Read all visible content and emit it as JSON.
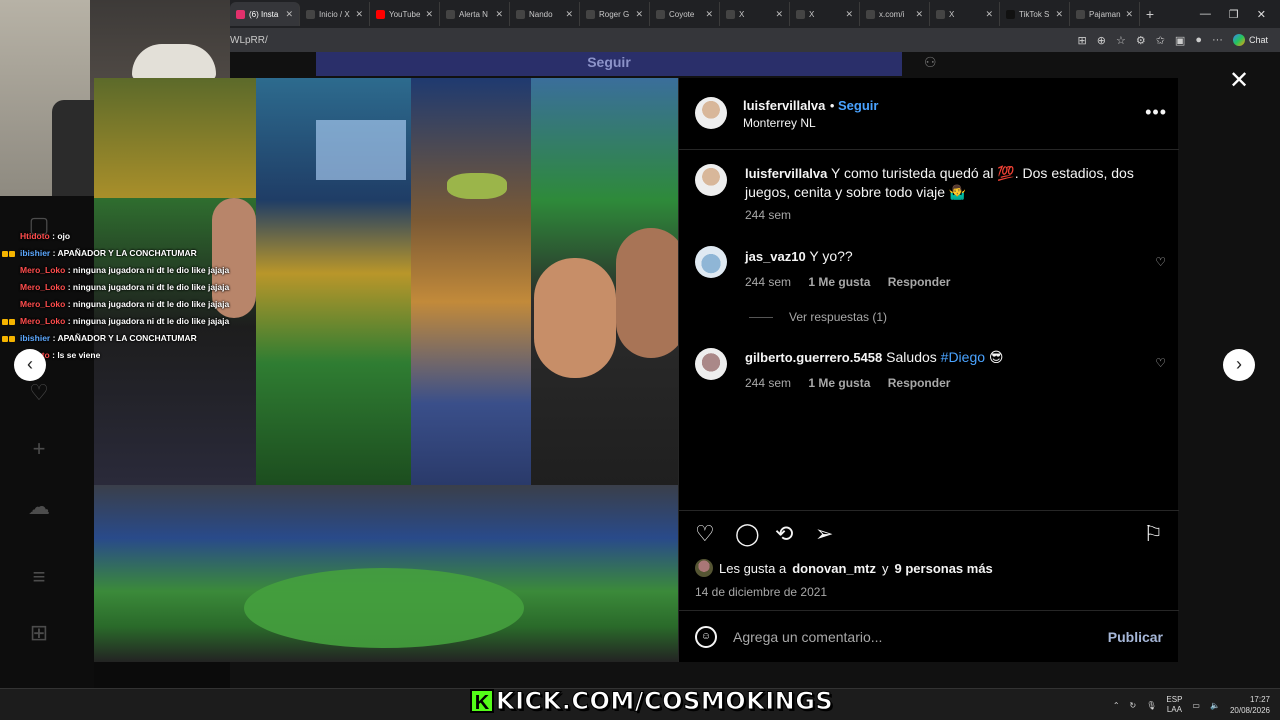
{
  "browser": {
    "tabs": [
      {
        "label": "(6) Insta",
        "active": true,
        "color": "#e1306c"
      },
      {
        "label": "Inicio / X",
        "active": false,
        "color": "#444444"
      },
      {
        "label": "YouTube",
        "active": false,
        "color": "#ff0000"
      },
      {
        "label": "Alerta N",
        "active": false,
        "color": "#444444"
      },
      {
        "label": "Nando",
        "active": false,
        "color": "#444444"
      },
      {
        "label": "Roger G",
        "active": false,
        "color": "#444444"
      },
      {
        "label": "Coyote",
        "active": false,
        "color": "#444444"
      },
      {
        "label": "X",
        "active": false,
        "color": "#444444"
      },
      {
        "label": "X",
        "active": false,
        "color": "#444444"
      },
      {
        "label": "x.com/i",
        "active": false,
        "color": "#444444"
      },
      {
        "label": "X",
        "active": false,
        "color": "#444444"
      },
      {
        "label": "TikTok S",
        "active": false,
        "color": "#111111"
      },
      {
        "label": "Pajaman",
        "active": false,
        "color": "#444444"
      }
    ],
    "url": "WLpRR/",
    "chat_label": "Chat"
  },
  "page_behind": {
    "follow_button": "Seguir"
  },
  "stream_chat": [
    {
      "user": "Htidoto",
      "text": "ojo",
      "badges": 0,
      "color": "red"
    },
    {
      "user": "ibishier",
      "text": "APAÑADOR Y LA CONCHATUMAR",
      "badges": 2,
      "color": "blue"
    },
    {
      "user": "Mero_Loko",
      "text": "ninguna jugadora ni dt le dio like jajaja",
      "badges": 0,
      "color": "red"
    },
    {
      "user": "Mero_Loko",
      "text": "ninguna jugadora ni dt le dio like jajaja",
      "badges": 0,
      "color": "red"
    },
    {
      "user": "Mero_Loko",
      "text": "ninguna jugadora ni dt le dio like jajaja",
      "badges": 0,
      "color": "red"
    },
    {
      "user": "Mero_Loko",
      "text": "ninguna jugadora ni dt le dio like jajaja",
      "badges": 2,
      "color": "red"
    },
    {
      "user": "ibishier",
      "text": "APAÑADOR Y LA CONCHATUMAR",
      "badges": 2,
      "color": "blue"
    },
    {
      "user": "Htidoto",
      "text": "ls se viene",
      "badges": 0,
      "color": "red"
    }
  ],
  "post": {
    "author": "luisfervillalva",
    "follow": "Seguir",
    "location": "Monterrey NL",
    "caption": "Y como turisteda quedó al 💯. Dos estadios, dos juegos, cenita y sobre todo viaje 🤷‍♂️",
    "caption_time": "244 sem",
    "comments": [
      {
        "user": "jas_vaz10",
        "text": "Y yo??",
        "time": "244 sem",
        "likes": "1 Me gusta",
        "reply": "Responder",
        "view_replies": "Ver respuestas (1)"
      },
      {
        "user": "gilberto.guerrero.5458",
        "text": "Saludos",
        "mention": "#Diego",
        "emoji": "😎",
        "time": "244 sem",
        "likes": "1 Me gusta",
        "reply": "Responder"
      }
    ],
    "likes_prefix": "Les gusta a",
    "likes_user": "donovan_mtz",
    "likes_mid": "y",
    "likes_others": "9 personas más",
    "date": "14 de diciembre de 2021",
    "comment_placeholder": "Agrega un comentario...",
    "publish": "Publicar"
  },
  "taskbar": {
    "lang1": "ESP",
    "lang2": "LAA",
    "time": "17:27",
    "date": "20/08/2026"
  },
  "overlay": {
    "kick_letter": "K",
    "kick_text": "KICK.COM/COSMOKINGS"
  },
  "colors": {
    "accent_blue": "#4aa3ff",
    "kick_green": "#53fc18"
  }
}
